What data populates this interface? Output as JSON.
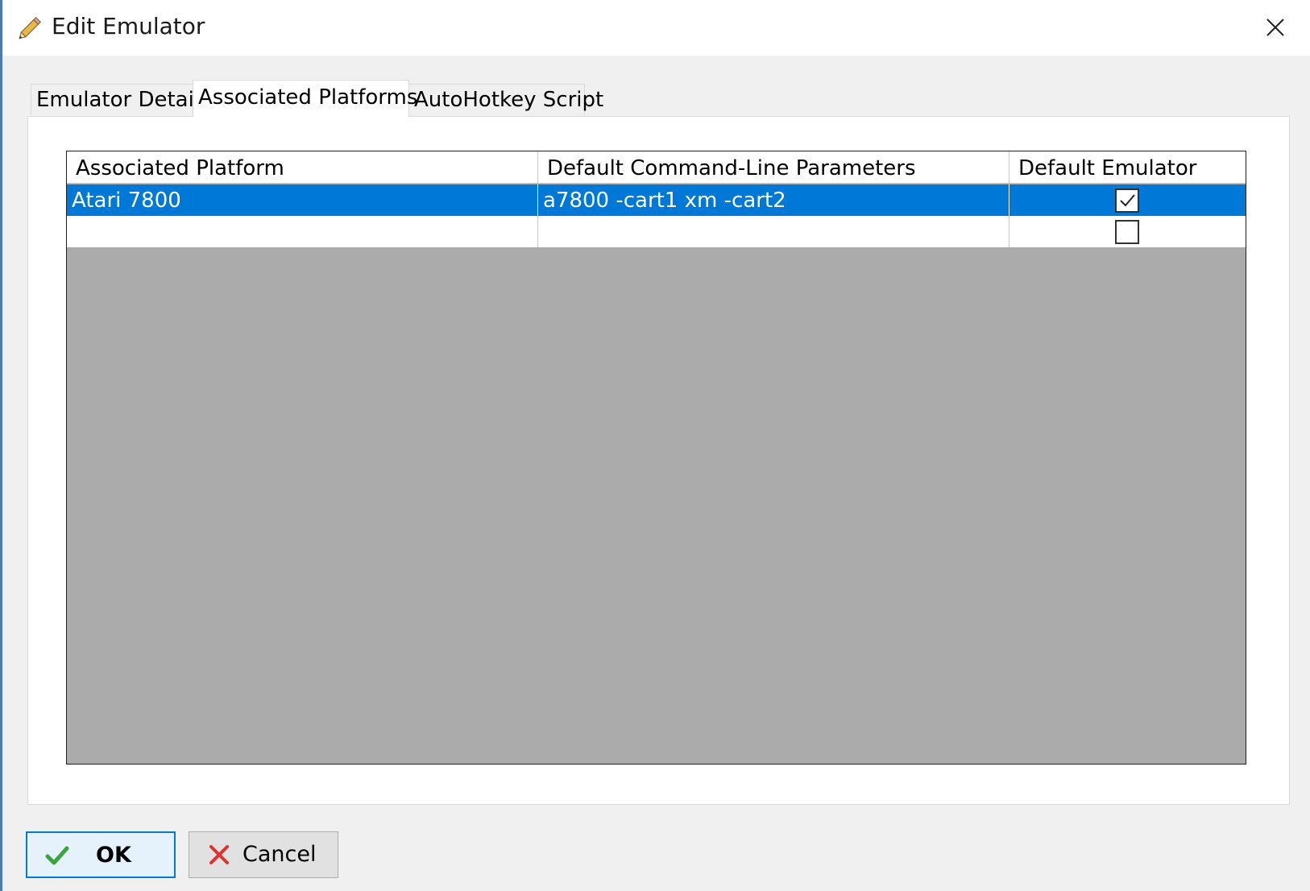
{
  "window": {
    "title": "Edit Emulator",
    "title_icon": "pencil-icon",
    "close_icon": "close-icon"
  },
  "tabs": [
    {
      "label": "Emulator Details",
      "active": false
    },
    {
      "label": "Associated Platforms",
      "active": true
    },
    {
      "label": "AutoHotkey Script",
      "active": false
    }
  ],
  "grid": {
    "columns": [
      "Associated Platform",
      "Default Command-Line Parameters",
      "Default Emulator"
    ],
    "rows": [
      {
        "platform": "Atari 7800",
        "params": "a7800 -cart1 xm -cart2",
        "default_emulator": true,
        "selected": true
      },
      {
        "platform": "",
        "params": "",
        "default_emulator": false,
        "selected": false
      }
    ]
  },
  "buttons": {
    "ok_label": "OK",
    "ok_icon": "checkmark-icon",
    "cancel_label": "Cancel",
    "cancel_icon": "cross-icon"
  },
  "colors": {
    "selection": "#0078d7",
    "grid_background": "#ababab"
  }
}
